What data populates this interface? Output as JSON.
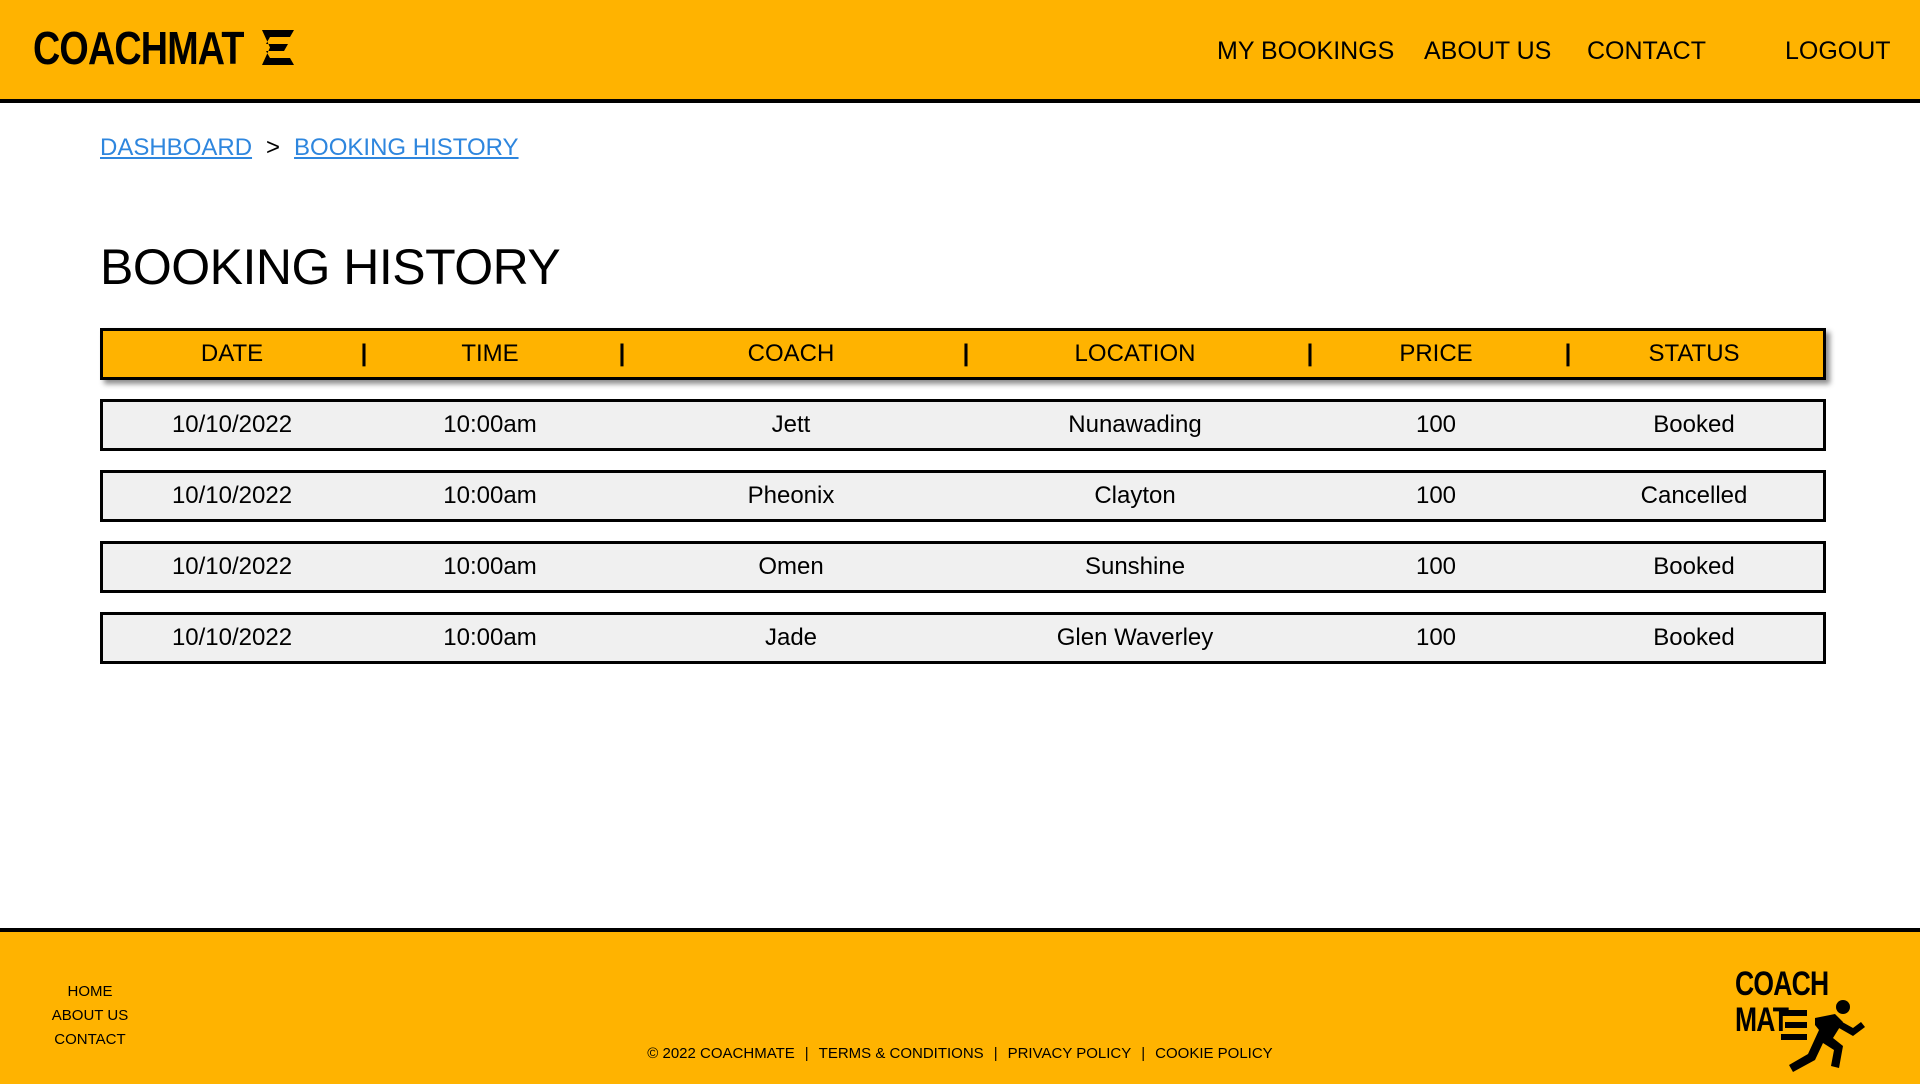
{
  "header": {
    "logo_text": "COACHMAT",
    "nav": {
      "my_bookings": "MY BOOKINGS",
      "about_us": "ABOUT US",
      "contact": "CONTACT",
      "logout": "LOGOUT"
    }
  },
  "breadcrumb": {
    "items": [
      "DASHBOARD",
      "BOOKING HISTORY"
    ],
    "separator": ">"
  },
  "page_title": "BOOKING HISTORY",
  "table": {
    "columns": [
      "DATE",
      "TIME",
      "COACH",
      "LOCATION",
      "PRICE",
      "STATUS"
    ],
    "divider": "|",
    "rows": [
      [
        "10/10/2022",
        "10:00am",
        "Jett",
        "Nunawading",
        "100",
        "Booked"
      ],
      [
        "10/10/2022",
        "10:00am",
        "Pheonix",
        "Clayton",
        "100",
        "Cancelled"
      ],
      [
        "10/10/2022",
        "10:00am",
        "Omen",
        "Sunshine",
        "100",
        "Booked"
      ],
      [
        "10/10/2022",
        "10:00am",
        "Jade",
        "Glen Waverley",
        "100",
        "Booked"
      ]
    ]
  },
  "footer": {
    "links": [
      "HOME",
      "ABOUT US",
      "CONTACT"
    ],
    "copyright": "© 2022 COACHMATE",
    "legal_links": [
      "TERMS & CONDITIONS",
      "PRIVACY POLICY",
      "COOKIE POLICY"
    ],
    "separator": "|",
    "logo_line1": "COACH",
    "logo_line2": "MAT"
  },
  "colors": {
    "brand": "#FFB300",
    "link": "#2E86DE",
    "row_bg": "#F0F0F0"
  },
  "icons": {
    "logo_mark": "stylized-e-icon",
    "footer_mark": "running-person-icon"
  }
}
